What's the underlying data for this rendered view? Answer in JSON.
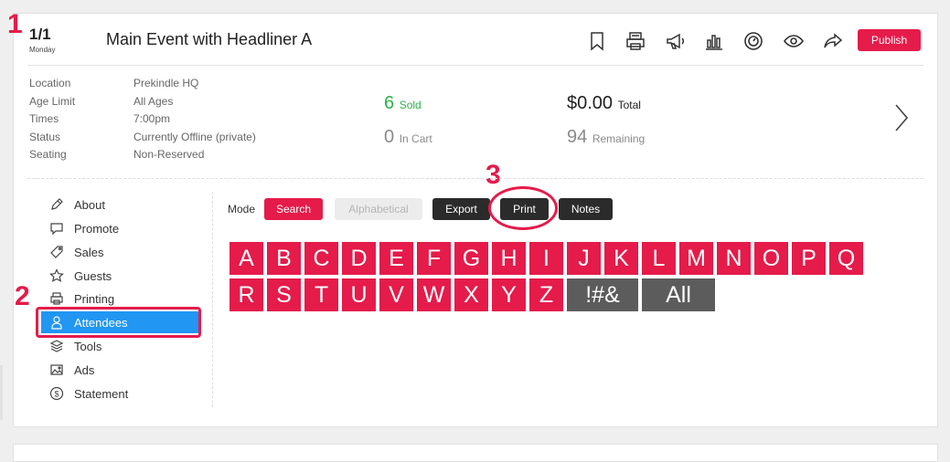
{
  "callouts": [
    "1",
    "2",
    "3"
  ],
  "event": {
    "date": "1/1",
    "day": "Monday",
    "title": "Main Event with Headliner A",
    "publish_label": "Publish"
  },
  "header_icons": [
    "bookmark-icon",
    "printer-icon",
    "megaphone-icon",
    "bar-chart-icon",
    "dashboard-icon",
    "eye-icon",
    "share-icon"
  ],
  "info": {
    "labels": [
      "Location",
      "Age Limit",
      "Times",
      "Status",
      "Seating"
    ],
    "values": [
      "Prekindle HQ",
      "All Ages",
      "7:00pm",
      "Currently Offline (private)",
      "Non-Reserved"
    ]
  },
  "stats": {
    "sold_num": "6",
    "sold_label": "Sold",
    "cart_num": "0",
    "cart_label": "In Cart",
    "total_num": "$0.00",
    "total_label": "Total",
    "remaining_num": "94",
    "remaining_label": "Remaining"
  },
  "sidebar": {
    "items": [
      {
        "label": "About",
        "icon": "pencil-icon"
      },
      {
        "label": "Promote",
        "icon": "speech-bubble-icon"
      },
      {
        "label": "Sales",
        "icon": "tag-icon"
      },
      {
        "label": "Guests",
        "icon": "star-icon"
      },
      {
        "label": "Printing",
        "icon": "printer-icon"
      },
      {
        "label": "Attendees",
        "icon": "person-icon",
        "active": true
      },
      {
        "label": "Tools",
        "icon": "layers-icon"
      },
      {
        "label": "Ads",
        "icon": "image-icon"
      },
      {
        "label": "Statement",
        "icon": "dollar-icon"
      }
    ]
  },
  "mode": {
    "label": "Mode",
    "search": "Search",
    "alphabetical": "Alphabetical",
    "export": "Export",
    "print": "Print",
    "notes": "Notes"
  },
  "letters_row1": [
    "A",
    "B",
    "C",
    "D",
    "E",
    "F",
    "G",
    "H",
    "I",
    "J",
    "K",
    "L",
    "M",
    "N",
    "O",
    "P",
    "Q"
  ],
  "letters_row2": [
    "R",
    "S",
    "T",
    "U",
    "V",
    "W",
    "X",
    "Y",
    "Z"
  ],
  "letters_special": [
    "!#&",
    "All"
  ],
  "colors": {
    "accent": "#e51b4a",
    "active": "#2196f3",
    "sold": "#2cb34a",
    "dark_button": "#2b2b2b"
  }
}
